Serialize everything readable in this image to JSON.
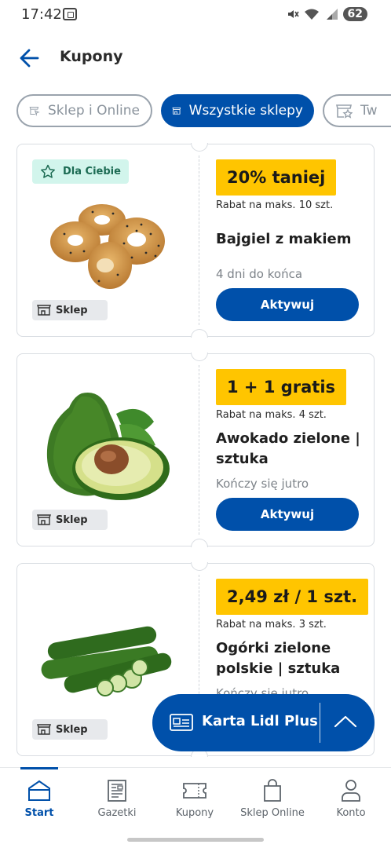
{
  "status_bar": {
    "time": "17:42",
    "battery": "62"
  },
  "header": {
    "title": "Kupony"
  },
  "filters": [
    {
      "label": "Sklep i Online",
      "icon": "store-online-icon"
    },
    {
      "label": "Wszystkie sklepy",
      "icon": "store-icon"
    },
    {
      "label": "Tw",
      "icon": "favorite-store-icon"
    }
  ],
  "coupons": [
    {
      "badge": "Dla Ciebie",
      "channel": "Sklep",
      "promo": "20% taniej",
      "limit": "Rabat na maks. 10 szt.",
      "name": "Bajgiel z makiem",
      "expiry": "4 dni do końca",
      "button": "Aktywuj"
    },
    {
      "channel": "Sklep",
      "promo": "1 + 1 gratis",
      "limit": "Rabat na maks. 4 szt.",
      "name": "Awokado zielone | sztuka",
      "expiry": "Kończy się jutro",
      "button": "Aktywuj"
    },
    {
      "channel": "Sklep",
      "promo": "2,49 zł / 1 szt.",
      "limit": "Rabat na maks. 3 szt.",
      "name": "Ogórki zielone polskie | sztuka",
      "expiry": "Kończy się jutro"
    }
  ],
  "lidl_card": {
    "label": "Karta Lidl Plus"
  },
  "bottom_nav": [
    {
      "label": "Start",
      "icon": "home-icon",
      "active": true
    },
    {
      "label": "Gazetki",
      "icon": "leaflet-icon"
    },
    {
      "label": "Kupony",
      "icon": "coupon-icon"
    },
    {
      "label": "Sklep Online",
      "icon": "shopping-bag-icon"
    },
    {
      "label": "Konto",
      "icon": "account-icon"
    }
  ],
  "colors": {
    "brand_blue": "#0050aa",
    "promo_yellow": "#ffc500",
    "badge_green": "#d2f5ec"
  }
}
